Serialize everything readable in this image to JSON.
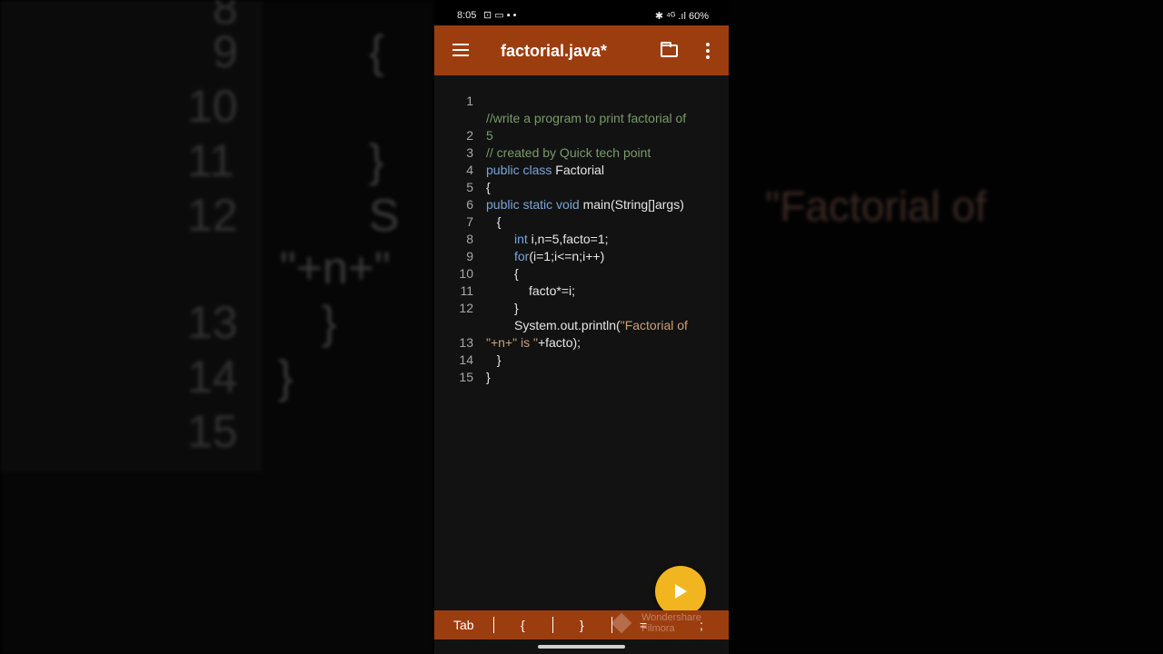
{
  "backdrop": {
    "left_numbers": [
      "8",
      "9",
      "10",
      "11",
      "12",
      "13",
      "14",
      "15"
    ],
    "left_code": [
      "{",
      "}",
      "S",
      "\"+n+\"",
      "}",
      "}"
    ],
    "right_text": "\"Factorial of"
  },
  "status": {
    "time": "8:05",
    "icons_left": "⊡ ▭ ▪ •",
    "right": "✱ ⁴ᴳ .ıl 60%",
    "battery": "60%"
  },
  "appbar": {
    "title": "factorial.java*",
    "menu_icon": "hamburger-menu-icon",
    "folder_icon": "folder-icon",
    "more_icon": "more-vertical-icon"
  },
  "editor": {
    "lines": [
      {
        "n": "1",
        "text": "//write a program to print factorial of"
      },
      {
        "n": "",
        "text": "5"
      },
      {
        "n": "2",
        "text": "// created by Quick tech point"
      },
      {
        "n": "3",
        "kw": "public class",
        "rest": " Factorial"
      },
      {
        "n": "4",
        "text": "{"
      },
      {
        "n": "5",
        "kw": "public static void",
        "rest": " main(String[]args)"
      },
      {
        "n": "6",
        "text": "  {"
      },
      {
        "n": "7",
        "kw": "int",
        "rest": " i,n=5,facto=1;"
      },
      {
        "n": "8",
        "kw": "for",
        "rest": "(i=1;i<=n;i++)"
      },
      {
        "n": "9",
        "text": "{"
      },
      {
        "n": "10",
        "text": "facto*=i;"
      },
      {
        "n": "11",
        "text": "}"
      },
      {
        "n": "12",
        "pre": "System.out.println(",
        "str": "\"Factorial of"
      },
      {
        "n": "",
        "str": "\"+n+\"",
        "mid": " is ",
        "str2": "\"",
        "rest": "+facto);"
      },
      {
        "n": "13",
        "text": "  }"
      },
      {
        "n": "14",
        "text": "}"
      },
      {
        "n": "15",
        "text": ""
      }
    ]
  },
  "fab": {
    "icon": "play-icon"
  },
  "keybar": {
    "keys": [
      "Tab",
      "{",
      "}",
      "=",
      ";"
    ],
    "watermark": [
      "Wondershare",
      "Filmora"
    ]
  },
  "colors": {
    "accent": "#9c3d10",
    "fab": "#f1b51f",
    "editor_bg": "#121212",
    "keyword": "#7aa5d8",
    "comment": "#7a9a6a",
    "string": "#c9a07a"
  }
}
